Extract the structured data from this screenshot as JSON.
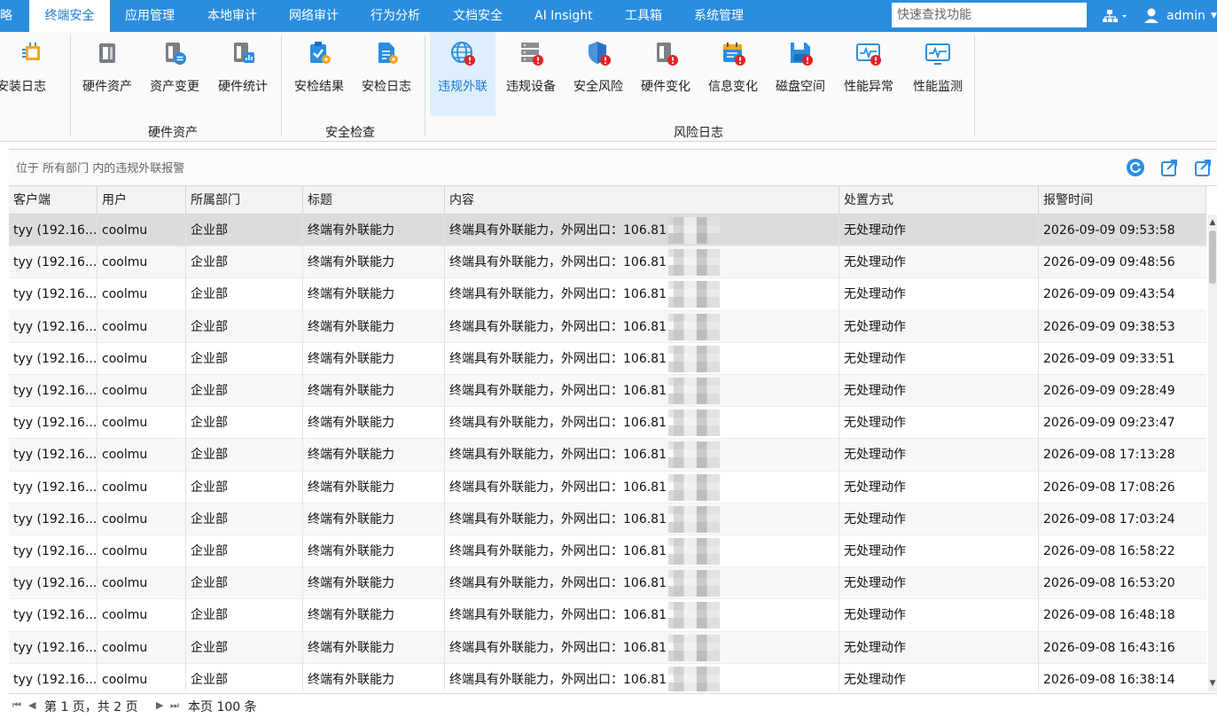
{
  "nav": {
    "items": [
      {
        "label": "略"
      },
      {
        "label": "终端安全"
      },
      {
        "label": "应用管理"
      },
      {
        "label": "本地审计"
      },
      {
        "label": "网络审计"
      },
      {
        "label": "行为分析"
      },
      {
        "label": "文档安全"
      },
      {
        "label": "AI Insight"
      },
      {
        "label": "工具箱"
      },
      {
        "label": "系统管理"
      }
    ],
    "active_index": 1,
    "search_placeholder": "快速查找功能",
    "org_icon": "org-chart-icon",
    "user_name": "admin",
    "colors": {
      "bar": "#2a8de0",
      "active_text": "#1a7ad4"
    }
  },
  "ribbon": {
    "buttons": [
      {
        "label": "安装日志",
        "icon": "install-log-icon",
        "group": 0,
        "active": false
      },
      {
        "label": "硬件资产",
        "icon": "hardware-asset-icon",
        "group": 1,
        "active": false
      },
      {
        "label": "资产变更",
        "icon": "asset-change-icon",
        "group": 1,
        "active": false
      },
      {
        "label": "硬件统计",
        "icon": "hardware-stats-icon",
        "group": 1,
        "active": false
      },
      {
        "label": "安检结果",
        "icon": "check-result-icon",
        "group": 2,
        "active": false
      },
      {
        "label": "安检日志",
        "icon": "check-log-icon",
        "group": 2,
        "active": false
      },
      {
        "label": "违规外联",
        "icon": "illegal-outreach-icon",
        "group": 3,
        "active": true
      },
      {
        "label": "违规设备",
        "icon": "illegal-device-icon",
        "group": 3,
        "active": false
      },
      {
        "label": "安全风险",
        "icon": "security-risk-icon",
        "group": 3,
        "active": false
      },
      {
        "label": "硬件变化",
        "icon": "hardware-change-icon",
        "group": 3,
        "active": false
      },
      {
        "label": "信息变化",
        "icon": "info-change-icon",
        "group": 3,
        "active": false
      },
      {
        "label": "磁盘空间",
        "icon": "disk-space-icon",
        "group": 3,
        "active": false
      },
      {
        "label": "性能异常",
        "icon": "perf-abnormal-icon",
        "group": 3,
        "active": false
      },
      {
        "label": "性能监测",
        "icon": "perf-monitor-icon",
        "group": 3,
        "active": false
      }
    ],
    "groups": [
      "硬件资产",
      "安全检查",
      "风险日志"
    ]
  },
  "caption": {
    "text": "位于 所有部门 内的违规外联报警",
    "refresh_icon": "refresh-icon",
    "export_icon": "export-icon",
    "export2_icon": "export-all-icon"
  },
  "table": {
    "columns": [
      "客户端",
      "用户",
      "所属部门",
      "标题",
      "内容",
      "处置方式",
      "报警时间"
    ],
    "rows": [
      {
        "client": "tyy (192.16...",
        "user": "coolmu",
        "dept": "企业部",
        "title": "终端有外联能力",
        "content": "终端具有外联能力，外网出口：106.81",
        "action": "无处理动作",
        "time": "2026-09-09 09:53:58"
      },
      {
        "client": "tyy (192.16...",
        "user": "coolmu",
        "dept": "企业部",
        "title": "终端有外联能力",
        "content": "终端具有外联能力，外网出口：106.81",
        "action": "无处理动作",
        "time": "2026-09-09 09:48:56"
      },
      {
        "client": "tyy (192.16...",
        "user": "coolmu",
        "dept": "企业部",
        "title": "终端有外联能力",
        "content": "终端具有外联能力，外网出口：106.81",
        "action": "无处理动作",
        "time": "2026-09-09 09:43:54"
      },
      {
        "client": "tyy (192.16...",
        "user": "coolmu",
        "dept": "企业部",
        "title": "终端有外联能力",
        "content": "终端具有外联能力，外网出口：106.81",
        "action": "无处理动作",
        "time": "2026-09-09 09:38:53"
      },
      {
        "client": "tyy (192.16...",
        "user": "coolmu",
        "dept": "企业部",
        "title": "终端有外联能力",
        "content": "终端具有外联能力，外网出口：106.81",
        "action": "无处理动作",
        "time": "2026-09-09 09:33:51"
      },
      {
        "client": "tyy (192.16...",
        "user": "coolmu",
        "dept": "企业部",
        "title": "终端有外联能力",
        "content": "终端具有外联能力，外网出口：106.81",
        "action": "无处理动作",
        "time": "2026-09-09 09:28:49"
      },
      {
        "client": "tyy (192.16...",
        "user": "coolmu",
        "dept": "企业部",
        "title": "终端有外联能力",
        "content": "终端具有外联能力，外网出口：106.81",
        "action": "无处理动作",
        "time": "2026-09-09 09:23:47"
      },
      {
        "client": "tyy (192.16...",
        "user": "coolmu",
        "dept": "企业部",
        "title": "终端有外联能力",
        "content": "终端具有外联能力，外网出口：106.81",
        "action": "无处理动作",
        "time": "2026-09-08 17:13:28"
      },
      {
        "client": "tyy (192.16...",
        "user": "coolmu",
        "dept": "企业部",
        "title": "终端有外联能力",
        "content": "终端具有外联能力，外网出口：106.81",
        "action": "无处理动作",
        "time": "2026-09-08 17:08:26"
      },
      {
        "client": "tyy (192.16...",
        "user": "coolmu",
        "dept": "企业部",
        "title": "终端有外联能力",
        "content": "终端具有外联能力，外网出口：106.81",
        "action": "无处理动作",
        "time": "2026-09-08 17:03:24"
      },
      {
        "client": "tyy (192.16...",
        "user": "coolmu",
        "dept": "企业部",
        "title": "终端有外联能力",
        "content": "终端具有外联能力，外网出口：106.81",
        "action": "无处理动作",
        "time": "2026-09-08 16:58:22"
      },
      {
        "client": "tyy (192.16...",
        "user": "coolmu",
        "dept": "企业部",
        "title": "终端有外联能力",
        "content": "终端具有外联能力，外网出口：106.81",
        "action": "无处理动作",
        "time": "2026-09-08 16:53:20"
      },
      {
        "client": "tyy (192.16...",
        "user": "coolmu",
        "dept": "企业部",
        "title": "终端有外联能力",
        "content": "终端具有外联能力，外网出口：106.81",
        "action": "无处理动作",
        "time": "2026-09-08 16:48:18"
      },
      {
        "client": "tyy (192.16...",
        "user": "coolmu",
        "dept": "企业部",
        "title": "终端有外联能力",
        "content": "终端具有外联能力，外网出口：106.81",
        "action": "无处理动作",
        "time": "2026-09-08 16:43:16"
      },
      {
        "client": "tyy (192.16...",
        "user": "coolmu",
        "dept": "企业部",
        "title": "终端有外联能力",
        "content": "终端具有外联能力，外网出口：106.81",
        "action": "无处理动作",
        "time": "2026-09-08 16:38:14"
      }
    ],
    "selected_index": 0
  },
  "pager": {
    "page_info": "第 1 页，共 2 页",
    "count_info": "本页 100 条"
  }
}
